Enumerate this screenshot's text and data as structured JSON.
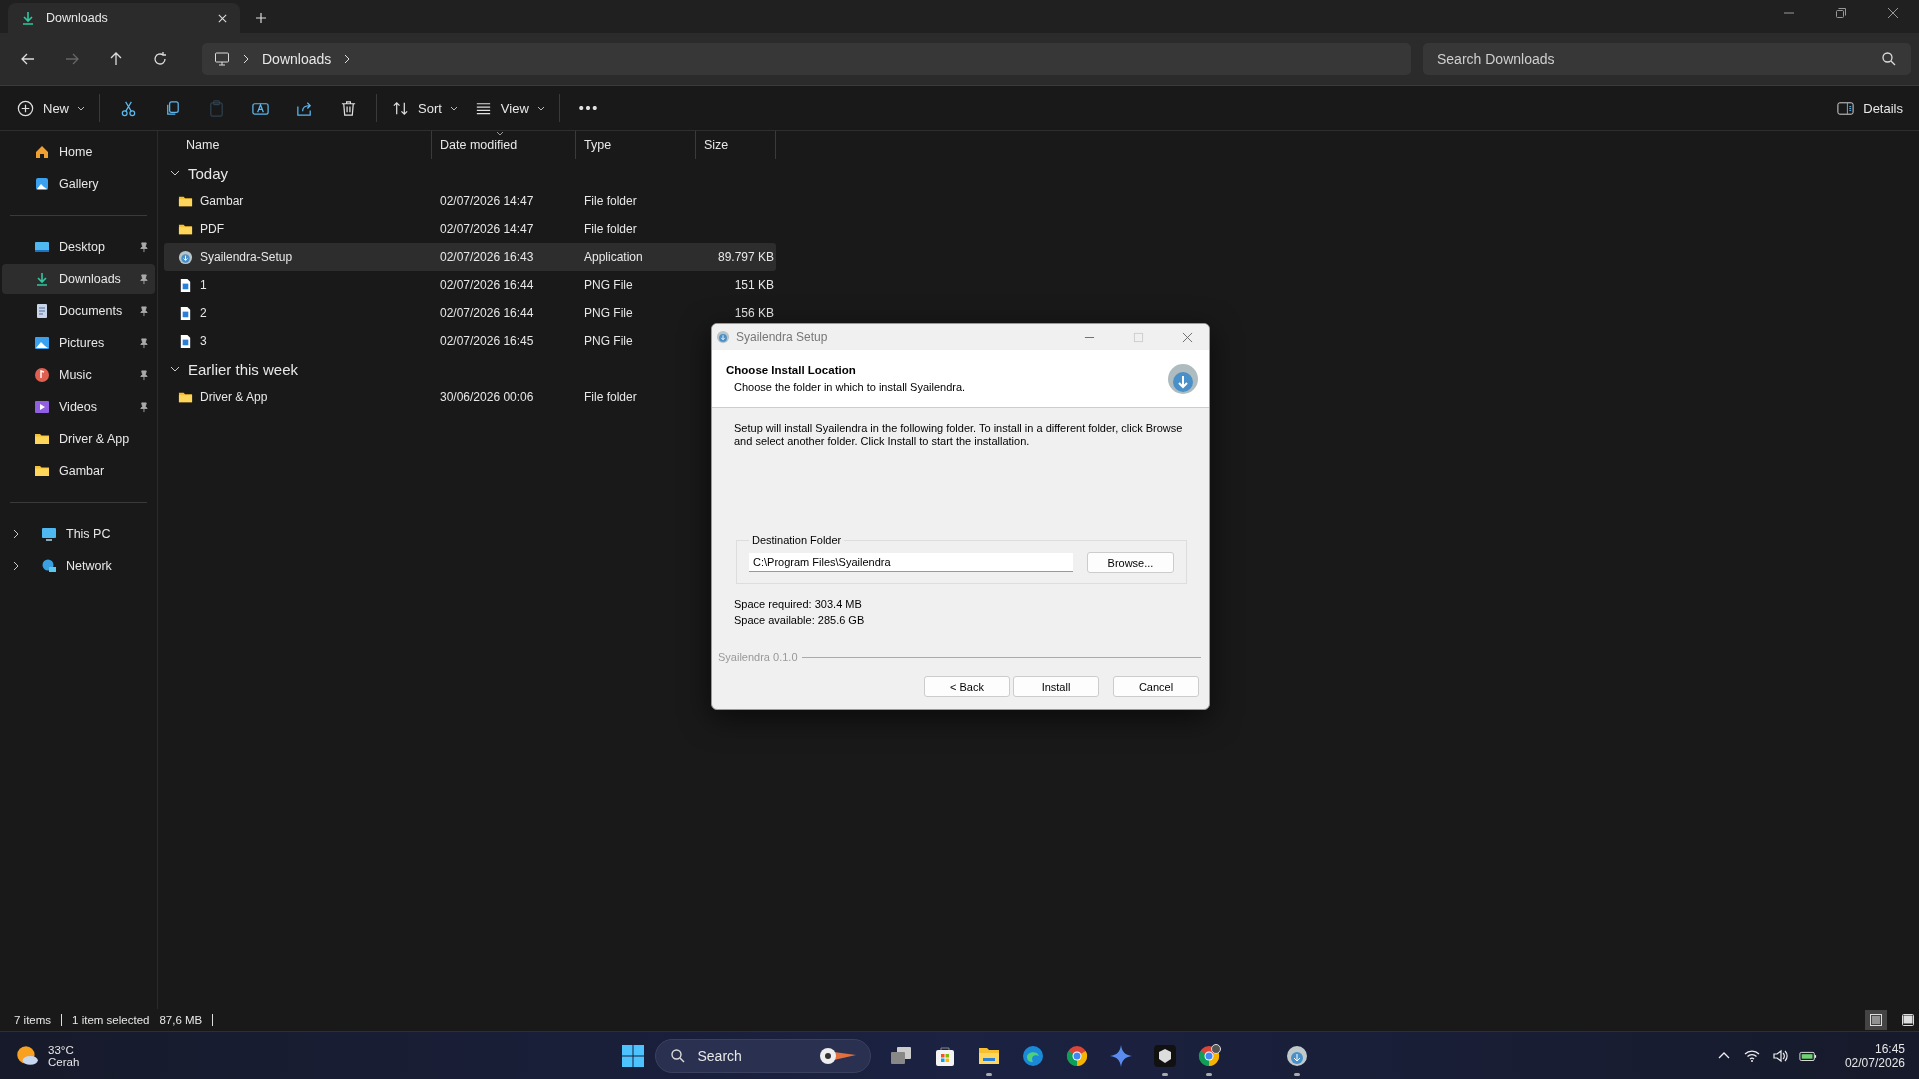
{
  "window": {
    "tab_title": "Downloads"
  },
  "navigation": [
    {
      "kind": "back",
      "disabled": false
    },
    {
      "kind": "forward",
      "disabled": true
    },
    {
      "kind": "up",
      "disabled": false
    },
    {
      "kind": "refresh",
      "disabled": false
    }
  ],
  "breadcrumb": [
    "Downloads"
  ],
  "search": {
    "placeholder": "Search Downloads"
  },
  "toolbar": [
    {
      "kind": "new",
      "label": "New",
      "disabled": false
    },
    {
      "kind": "cut",
      "disabled": false
    },
    {
      "kind": "copy",
      "disabled": false
    },
    {
      "kind": "paste",
      "disabled": true
    },
    {
      "kind": "rename",
      "disabled": false
    },
    {
      "kind": "share",
      "disabled": false
    },
    {
      "kind": "delete",
      "disabled": false
    },
    {
      "kind": "sort",
      "label": "Sort",
      "disabled": false
    },
    {
      "kind": "view",
      "label": "View",
      "disabled": false
    },
    {
      "kind": "more",
      "disabled": false
    }
  ],
  "details_button": {
    "label": "Details"
  },
  "sidebar": {
    "top": [
      {
        "kind": "home",
        "label": "Home",
        "selected": false
      },
      {
        "kind": "gallery",
        "label": "Gallery",
        "selected": false
      }
    ],
    "quick_access": [
      {
        "kind": "desktop",
        "label": "Desktop",
        "pinned": true,
        "selected": false
      },
      {
        "kind": "downloads",
        "label": "Downloads",
        "pinned": true,
        "selected": true
      },
      {
        "kind": "documents",
        "label": "Documents",
        "pinned": true,
        "selected": false
      },
      {
        "kind": "pictures",
        "label": "Pictures",
        "pinned": true,
        "selected": false
      },
      {
        "kind": "music",
        "label": "Music",
        "pinned": true,
        "selected": false
      },
      {
        "kind": "videos",
        "label": "Videos",
        "pinned": true,
        "selected": false
      },
      {
        "kind": "folder",
        "label": "Driver & App",
        "pinned": false,
        "selected": false
      },
      {
        "kind": "folder",
        "label": "Gambar",
        "pinned": false,
        "selected": false
      }
    ],
    "locations": [
      {
        "kind": "pc",
        "label": "This PC",
        "expanded": false
      },
      {
        "kind": "network",
        "label": "Network",
        "expanded": false
      }
    ]
  },
  "table": {
    "columns": [
      {
        "label": "Name",
        "sorted": false
      },
      {
        "label": "Date modified",
        "sorted": true
      },
      {
        "label": "Type",
        "sorted": false
      },
      {
        "label": "Size",
        "sorted": false
      }
    ],
    "groups": [
      {
        "label": "Today",
        "expanded": true,
        "rows": [
          {
            "kind": "folder",
            "name": "Gambar",
            "date": "02/07/2026 14:47",
            "type": "File folder",
            "selected": false
          },
          {
            "kind": "folder",
            "name": "PDF",
            "date": "02/07/2026 14:47",
            "type": "File folder",
            "selected": false
          },
          {
            "kind": "app",
            "name": "Syailendra-Setup",
            "date": "02/07/2026 16:43",
            "type": "Application",
            "size": "89.797 KB",
            "selected": true
          },
          {
            "kind": "image",
            "name": "1",
            "date": "02/07/2026 16:44",
            "type": "PNG File",
            "size": "151 KB",
            "selected": false
          },
          {
            "kind": "image",
            "name": "2",
            "date": "02/07/2026 16:44",
            "type": "PNG File",
            "size": "156 KB",
            "selected": false
          },
          {
            "kind": "image",
            "name": "3",
            "date": "02/07/2026 16:45",
            "type": "PNG File",
            "selected": false
          }
        ]
      },
      {
        "label": "Earlier this week",
        "expanded": true,
        "rows": [
          {
            "kind": "folder",
            "name": "Driver & App",
            "date": "30/06/2026 00:06",
            "type": "File folder",
            "selected": false
          }
        ]
      }
    ]
  },
  "status_bar": {
    "items": "7 items",
    "selection": "1 item selected",
    "selection_size": "87,6 MB",
    "views": [
      {
        "kind": "details",
        "selected": true
      },
      {
        "kind": "tiles",
        "selected": false
      }
    ]
  },
  "dialog": {
    "title": "Syailendra Setup",
    "heading": "Choose Install Location",
    "subheading": "Choose the folder in which to install Syailendra.",
    "body": "Setup will install Syailendra in the following folder. To install in a different folder, click Browse and select another folder. Click Install to start the installation.",
    "group_label": "Destination Folder",
    "path": "C:\\Program Files\\Syailendra",
    "browse": "Browse...",
    "space_required": "Space required: 303.4 MB",
    "space_available": "Space available: 285.6 GB",
    "brand": "Syailendra 0.1.0",
    "buttons": [
      "< Back",
      "Install",
      "Cancel"
    ],
    "maximize_disabled": true
  },
  "taskbar": {
    "weather": {
      "temperature": "33°C",
      "condition": "Cerah"
    },
    "search_label": "Search",
    "apps": [
      {
        "kind": "taskview",
        "running": false
      },
      {
        "kind": "store",
        "running": false
      },
      {
        "kind": "explorer",
        "running": true
      },
      {
        "kind": "edge",
        "running": false
      },
      {
        "kind": "chrome",
        "running": false
      },
      {
        "kind": "sparkle",
        "running": false
      },
      {
        "kind": "cube",
        "running": true
      },
      {
        "kind": "chrome-profile",
        "running": true
      },
      {
        "kind": "setup",
        "running": true
      }
    ],
    "time": "16:45",
    "date": "02/07/2026"
  }
}
